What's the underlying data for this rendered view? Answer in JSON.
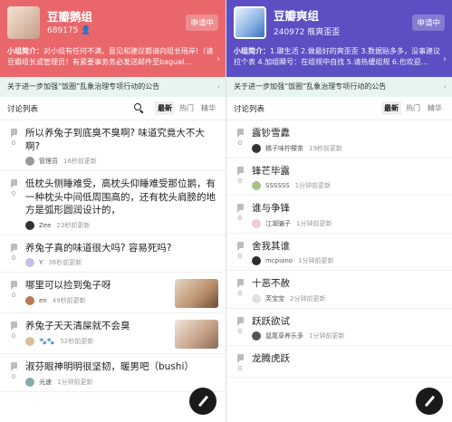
{
  "left": {
    "header": {
      "group_name": "豆瓣鹅组",
      "member_count": "689175",
      "member_icon": "user-icon",
      "apply_label": "申请中",
      "intro_label": "小组简介：",
      "intro_text": "对小组有任何不满，意见和建议都请向组长瑶岸!（请豆瓣组长或管理员！有紧要事务务必发送邮件至baguaI..."
    },
    "notice": "关于进一步加强“饭圈”乱象治理专项行动的公告",
    "list": {
      "title": "讨论列表",
      "tabs": [
        "最新",
        "热门",
        "精华"
      ],
      "active_tab": "最新"
    },
    "posts": [
      {
        "title": "所以养兔子到底臭不臭啊? 味道究竟大不大啊?",
        "votes": "0",
        "author": "管理员",
        "time": "16秒前更新",
        "avatar_color": "#9a9a9a"
      },
      {
        "title": "低枕头侧睡难受，高枕头仰睡难受那位鹅，有一种枕头中间低周围高的，还有枕头肩膀的地方是弧形圆润设计的，",
        "votes": "0",
        "author": "Zee",
        "time": "23秒前更新",
        "avatar_color": "#333333"
      },
      {
        "title": "养兔子真的味道很大吗? 容易死吗?",
        "votes": "0",
        "author": "Y",
        "time": "36秒前更新",
        "avatar_color": "#c9c0ea"
      },
      {
        "title": "哪里可以捡到兔子呀",
        "votes": "0",
        "author": "en",
        "time": "49秒前更新",
        "avatar_color": "#b97a55",
        "thumb": "#c8a988"
      },
      {
        "title": "养兔子天天清屎就不会臭",
        "votes": "0",
        "author": "🐾🐾",
        "time": "52秒前更新",
        "avatar_color": "#d7c19c",
        "thumb": "#b38e74"
      },
      {
        "title": "淑芬眼神明明很坚韧，暖男吧（bushi）",
        "votes": "0",
        "author": "光速",
        "time": "1分钟前更新",
        "avatar_color": "#8aa"
      }
    ]
  },
  "right": {
    "header": {
      "group_name": "豆瓣爽组",
      "member_count": "240972",
      "member_suffix": "瓶爽歪歪",
      "apply_label": "申请中",
      "intro_label": "小组简介：",
      "intro_text": "1.聊生活 2.做最好的爽歪歪 3.数据贴多多，没事建议拉个表 4.加组瞬号：在组规中自找 5.请热缓组规 6.也欢迎..."
    },
    "notice": "关于进一步加强“饭圈”乱象治理专项行动的公告",
    "list": {
      "title": "讨论列表",
      "tabs": [
        "最新",
        "热门",
        "精华"
      ],
      "active_tab": "最新"
    },
    "posts": [
      {
        "title": "露钞雪纛",
        "votes": "0",
        "author": "橘子味柠檬茶",
        "time": "19秒前更新",
        "avatar_color": "#333333"
      },
      {
        "title": "锋芒毕露",
        "votes": "0",
        "author": "SSSSSS",
        "time": "1分钟前更新",
        "avatar_color": "#a8c18a"
      },
      {
        "title": "谁与争锋",
        "votes": "0",
        "author": "江湖骗子",
        "time": "1分钟前更新",
        "avatar_color": "#f3c9d2"
      },
      {
        "title": "舍我其谁",
        "votes": "0",
        "author": "mcpiano",
        "time": "1分钟前更新",
        "avatar_color": "#2d2d2d"
      },
      {
        "title": "十恶不赦",
        "votes": "0",
        "author": "芙宝宝",
        "time": "2分钟前更新",
        "avatar_color": "#e0e0e0"
      },
      {
        "title": "跃跃欲试",
        "votes": "0",
        "author": "鼠尾草养乐多",
        "time": "1分钟前更新",
        "avatar_color": "#555555"
      },
      {
        "title": "龙腾虎跃",
        "votes": "0",
        "author": "",
        "time": "",
        "avatar_color": "#bbbbbb"
      }
    ]
  },
  "colors": {
    "left_header": "#e9676b",
    "right_header": "#5b4fc3",
    "notice_bg": "#e8f5ee"
  },
  "icons": {
    "fab": "pen-icon",
    "search": "search-icon",
    "notice_chevron": "chevron-right-icon",
    "vote": "comment-icon"
  }
}
